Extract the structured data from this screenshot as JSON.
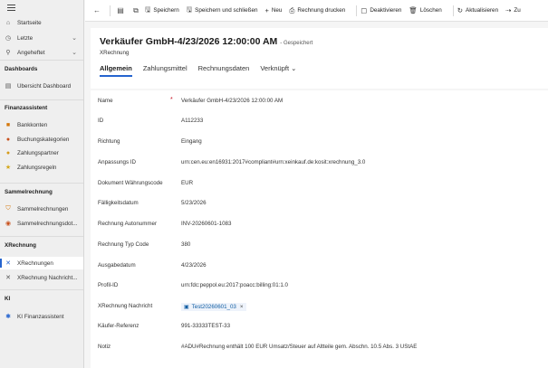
{
  "sidebar": {
    "top": [
      {
        "label": "Startseite",
        "icon": "home-icon",
        "glyph": "⌂",
        "chev": ""
      },
      {
        "label": "Letzte",
        "icon": "clock-icon",
        "glyph": "◷",
        "chev": "⌄"
      },
      {
        "label": "Angeheftet",
        "icon": "pin-icon",
        "glyph": "⚲",
        "chev": "⌄"
      }
    ],
    "groups": [
      {
        "title": "Dashboards",
        "items": [
          {
            "label": "Übersicht Dashboard",
            "icon": "dashboard-icon",
            "glyph": "▤",
            "color": "#555"
          }
        ]
      },
      {
        "title": "Finanzassistent",
        "items": [
          {
            "label": "Bankkonten",
            "icon": "bank-icon",
            "glyph": "■",
            "color": "#d4770b"
          },
          {
            "label": "Buchungskategorien",
            "icon": "category-icon",
            "glyph": "●",
            "color": "#c8501c"
          },
          {
            "label": "Zahlungspartner",
            "icon": "partner-icon",
            "glyph": "●",
            "color": "#d69b1a"
          },
          {
            "label": "Zahlungsregeln",
            "icon": "rule-icon",
            "glyph": "★",
            "color": "#d4a71a"
          }
        ]
      },
      {
        "title": "Sammelrechnung",
        "items": [
          {
            "label": "Sammelrechnungen",
            "icon": "invoice-shield-icon",
            "glyph": "⛉",
            "color": "#d4770b"
          },
          {
            "label": "Sammelrechnungsdot...",
            "icon": "invoice-doc-icon",
            "glyph": "◉",
            "color": "#c8501c"
          }
        ]
      },
      {
        "title": "XRechnung",
        "items": [
          {
            "label": "XRechnungen",
            "icon": "xinvoice-icon",
            "glyph": "✕",
            "color": "#2564cf",
            "active": true
          },
          {
            "label": "XRechnung Nachricht...",
            "icon": "xmessage-icon",
            "glyph": "✕",
            "color": "#555"
          }
        ]
      },
      {
        "title": "KI",
        "items": [
          {
            "label": "KI Finanzassistent",
            "icon": "ai-icon",
            "glyph": "✱",
            "color": "#2564cf"
          }
        ]
      }
    ]
  },
  "toolbar": {
    "buttons": [
      {
        "label": "Speichern",
        "icon": "save-icon",
        "glyph": "🖫"
      },
      {
        "label": "Speichern und schließen",
        "icon": "save-close-icon",
        "glyph": "🖫"
      },
      {
        "label": "Neu",
        "icon": "plus-icon",
        "glyph": "+"
      },
      {
        "label": "Rechnung drucken",
        "icon": "print-icon",
        "glyph": "⎙"
      },
      {
        "label": "Deaktivieren",
        "icon": "deactivate-icon",
        "glyph": "▢"
      },
      {
        "label": "Löschen",
        "icon": "delete-icon",
        "glyph": "🗑"
      },
      {
        "label": "Aktualisieren",
        "icon": "refresh-icon",
        "glyph": "↻"
      },
      {
        "label": "Zu",
        "icon": "assign-icon",
        "glyph": "⇢"
      }
    ]
  },
  "header": {
    "title": "Verkäufer GmbH-4/23/2026 12:00:00 AM",
    "saved": "- Gespeichert",
    "subtitle": "XRechnung",
    "tabs": [
      {
        "label": "Allgemein",
        "active": true
      },
      {
        "label": "Zahlungsmittel"
      },
      {
        "label": "Rechnungsdaten"
      },
      {
        "label": "Verknüpft ⌄"
      }
    ]
  },
  "form": [
    {
      "label": "Name",
      "value": "Verkäufer GmbH-4/23/2026 12:00:00 AM",
      "required": true
    },
    {
      "label": "ID",
      "value": "A112233"
    },
    {
      "label": "Richtung",
      "value": "Eingang"
    },
    {
      "label": "Anpassungs ID",
      "value": "urn:cen.eu:en16931:2017#compliant#urn:xeinkauf.de:kosit:xrechnung_3.0"
    },
    {
      "label": "Dokument Währungscode",
      "value": "EUR"
    },
    {
      "label": "Fälligkeitsdatum",
      "value": "5/23/2026"
    },
    {
      "label": "Rechnung Autonummer",
      "value": "INV-20260601-1083"
    },
    {
      "label": "Rechnung Typ Code",
      "value": "380"
    },
    {
      "label": "Ausgabedatum",
      "value": "4/23/2026"
    },
    {
      "label": "Profil-ID",
      "value": "urn:fdc:peppol.eu:2017:poacc:billing:01:1.0"
    },
    {
      "label": "XRechnung Nachricht",
      "value": "Test20260601_03",
      "lookup": true
    },
    {
      "label": "Käufer-Referenz",
      "value": "991-33333TEST-33"
    },
    {
      "label": "Notiz",
      "value": "#ADU#Rechnung enthält 100 EUR Umsatz/Steuer auf Altteile gem. Abschn. 10.5 Abs. 3 UStAE"
    }
  ],
  "colors": {
    "accent": "#2564cf",
    "required": "#c50f1f"
  }
}
